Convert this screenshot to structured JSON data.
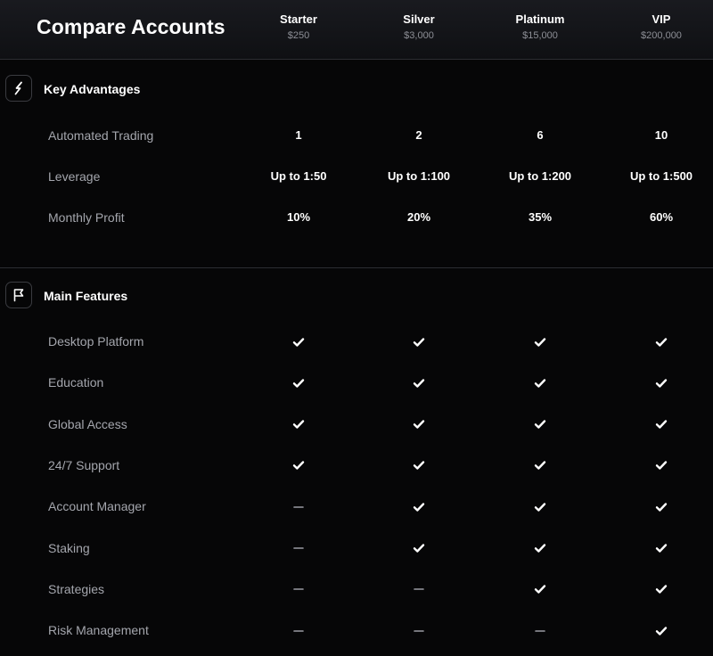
{
  "header": {
    "title": "Compare Accounts",
    "plans": [
      {
        "name": "Starter",
        "price": "$250"
      },
      {
        "name": "Silver",
        "price": "$3,000"
      },
      {
        "name": "Platinum",
        "price": "$15,000"
      },
      {
        "name": "VIP",
        "price": "$200,000"
      }
    ]
  },
  "sections": [
    {
      "title": "Key Advantages",
      "icon": "lightning-icon",
      "rows": [
        {
          "label": "Automated Trading",
          "values": [
            "1",
            "2",
            "6",
            "10"
          ]
        },
        {
          "label": "Leverage",
          "values": [
            "Up to 1:50",
            "Up to 1:100",
            "Up to 1:200",
            "Up to 1:500"
          ]
        },
        {
          "label": "Monthly Profit",
          "values": [
            "10%",
            "20%",
            "35%",
            "60%"
          ]
        }
      ]
    },
    {
      "title": "Main Features",
      "icon": "flag-icon",
      "rows": [
        {
          "label": "Desktop Platform",
          "values": [
            "check",
            "check",
            "check",
            "check"
          ]
        },
        {
          "label": "Education",
          "values": [
            "check",
            "check",
            "check",
            "check"
          ]
        },
        {
          "label": "Global Access",
          "values": [
            "check",
            "check",
            "check",
            "check"
          ]
        },
        {
          "label": "24/7 Support",
          "values": [
            "check",
            "check",
            "check",
            "check"
          ]
        },
        {
          "label": "Account Manager",
          "values": [
            "dash",
            "check",
            "check",
            "check"
          ]
        },
        {
          "label": "Staking",
          "values": [
            "dash",
            "check",
            "check",
            "check"
          ]
        },
        {
          "label": "Strategies",
          "values": [
            "dash",
            "dash",
            "check",
            "check"
          ]
        },
        {
          "label": "Risk Management",
          "values": [
            "dash",
            "dash",
            "dash",
            "check"
          ]
        }
      ]
    }
  ],
  "colors": {
    "background": "#060607",
    "header": "#16171b",
    "label": "#a4a6ad",
    "price": "#8d8f96",
    "dash": "#9a9ca3"
  }
}
